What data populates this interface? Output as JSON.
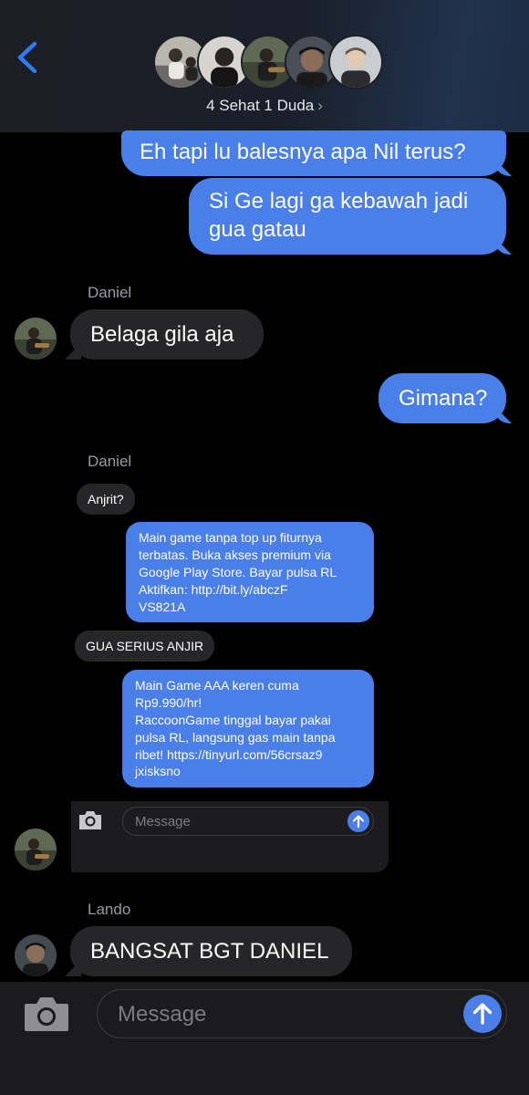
{
  "header": {
    "group_name": "4 Sehat 1 Duda",
    "chevron": "›",
    "back_icon": "chevron-left-icon",
    "accent": "#2f7cf6"
  },
  "messages": {
    "m1": "Eh tapi lu balesnya apa Nil terus?",
    "m2_line1": "Si Ge lagi ga kebawah jadi",
    "m2_line2": "gua gatau",
    "sender_daniel_1": "Daniel",
    "m3": "Belaga gila aja",
    "m4": "Gimana?",
    "sender_daniel_2": "Daniel",
    "sender_lando": "Lando",
    "m_last": "BANGSAT BGT DANIEL"
  },
  "embedded": {
    "e1": "Anjrit?",
    "e2_lines": [
      "Main game tanpa top up fiturnya",
      "terbatas. Buka akses premium via",
      "Google Play Store. Bayar pulsa RL",
      "Aktifkan: http://bit.ly/abczF",
      "VS821A"
    ],
    "e3": "GUA SERIUS ANJIR",
    "e4_lines": [
      "Main Game AAA keren cuma",
      "Rp9.990/hr!",
      "RaccoonGame tinggal bayar pakai",
      "pulsa RL, langsung gas main tanpa",
      "ribet! https://tinyurl.com/56crsaz9",
      "jxisksno"
    ],
    "input_placeholder": "Message"
  },
  "composer": {
    "placeholder": "Message",
    "camera_icon": "camera-icon",
    "send_icon": "arrow-up-icon"
  },
  "colors": {
    "outgoing_bubble": "#4a7ee8",
    "incoming_bubble": "#262628",
    "background": "#000000"
  }
}
